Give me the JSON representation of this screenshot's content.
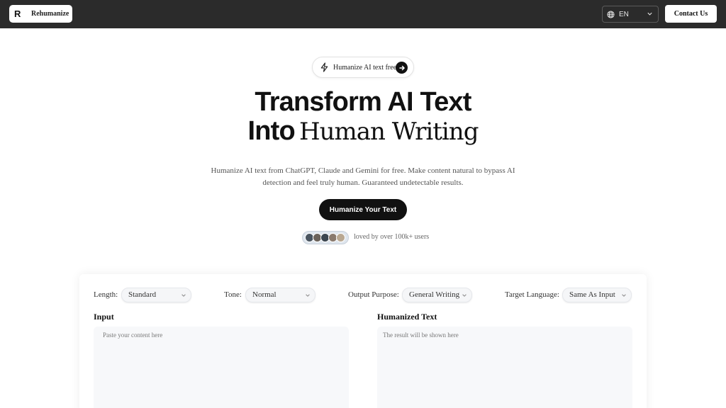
{
  "header": {
    "brand": "Rehumanize",
    "language": "EN",
    "contact_label": "Contact Us"
  },
  "hero": {
    "pill_text": "Humanize AI text free",
    "title_line1": "Transform AI Text",
    "title_into": "Into",
    "title_human": "Human Writing",
    "subtitle": "Humanize AI text from ChatGPT, Claude and Gemini for free. Make content natural to bypass AI detection and feel truly human. Guaranteed undetectable results.",
    "cta_label": "Humanize Your Text",
    "social_proof": "loved by over 100k+ users"
  },
  "tool": {
    "options": [
      {
        "label": "Length:",
        "value": "Standard"
      },
      {
        "label": "Tone:",
        "value": "Normal"
      },
      {
        "label": "Output Purpose:",
        "value": "General Writing"
      },
      {
        "label": "Target Language:",
        "value": "Same As Input"
      }
    ],
    "input_title": "Input",
    "input_placeholder": "Paste your content here",
    "output_title": "Humanized Text",
    "output_placeholder": "The result will be shown here"
  },
  "colors": {
    "topbar": "#2b2b2b",
    "primary": "#111111",
    "textarea_bg": "#f7f8fa"
  },
  "icons": {
    "logo": "r-logo-icon",
    "language": "globe-icon",
    "dropdown": "chevron-down-icon",
    "pill": "lightning-icon",
    "pill_action": "arrow-right-icon"
  }
}
